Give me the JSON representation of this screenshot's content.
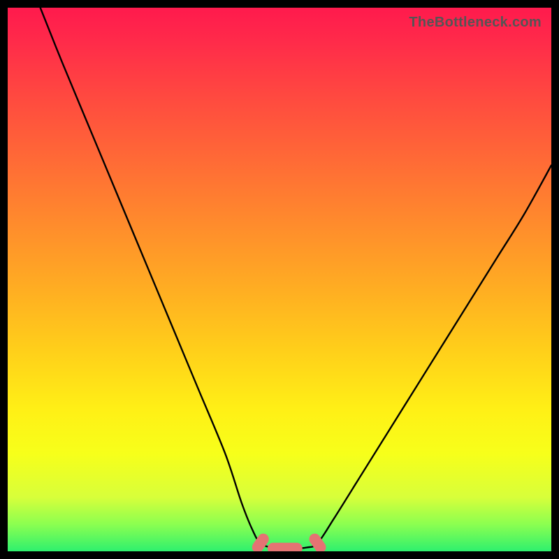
{
  "watermark": "TheBottleneck.com",
  "colors": {
    "frame": "#000000",
    "curve_stroke": "#000000",
    "marker_fill": "#e57373",
    "marker_stroke": "#c0504d"
  },
  "chart_data": {
    "type": "line",
    "title": "",
    "xlabel": "",
    "ylabel": "",
    "xlim": [
      0,
      100
    ],
    "ylim": [
      0,
      100
    ],
    "grid": false,
    "legend": false,
    "series": [
      {
        "name": "left-branch",
        "x": [
          6,
          10,
          15,
          20,
          25,
          30,
          35,
          40,
          43,
          45,
          46.5
        ],
        "y": [
          100,
          90,
          78,
          66,
          54,
          42,
          30,
          18,
          9,
          4,
          1.5
        ]
      },
      {
        "name": "valley-floor",
        "x": [
          46.5,
          49,
          52,
          55,
          57
        ],
        "y": [
          1.5,
          0.6,
          0.5,
          0.7,
          1.5
        ]
      },
      {
        "name": "right-branch",
        "x": [
          57,
          60,
          65,
          70,
          75,
          80,
          85,
          90,
          95,
          100
        ],
        "y": [
          1.5,
          6,
          14,
          22,
          30,
          38,
          46,
          54,
          62,
          71
        ]
      }
    ],
    "markers": [
      {
        "x": 46.5,
        "y": 1.5,
        "shape": "pill",
        "angle": -55
      },
      {
        "x": 51,
        "y": 0.55,
        "shape": "pill",
        "angle": 0
      },
      {
        "x": 57,
        "y": 1.5,
        "shape": "pill",
        "angle": 55
      }
    ]
  }
}
